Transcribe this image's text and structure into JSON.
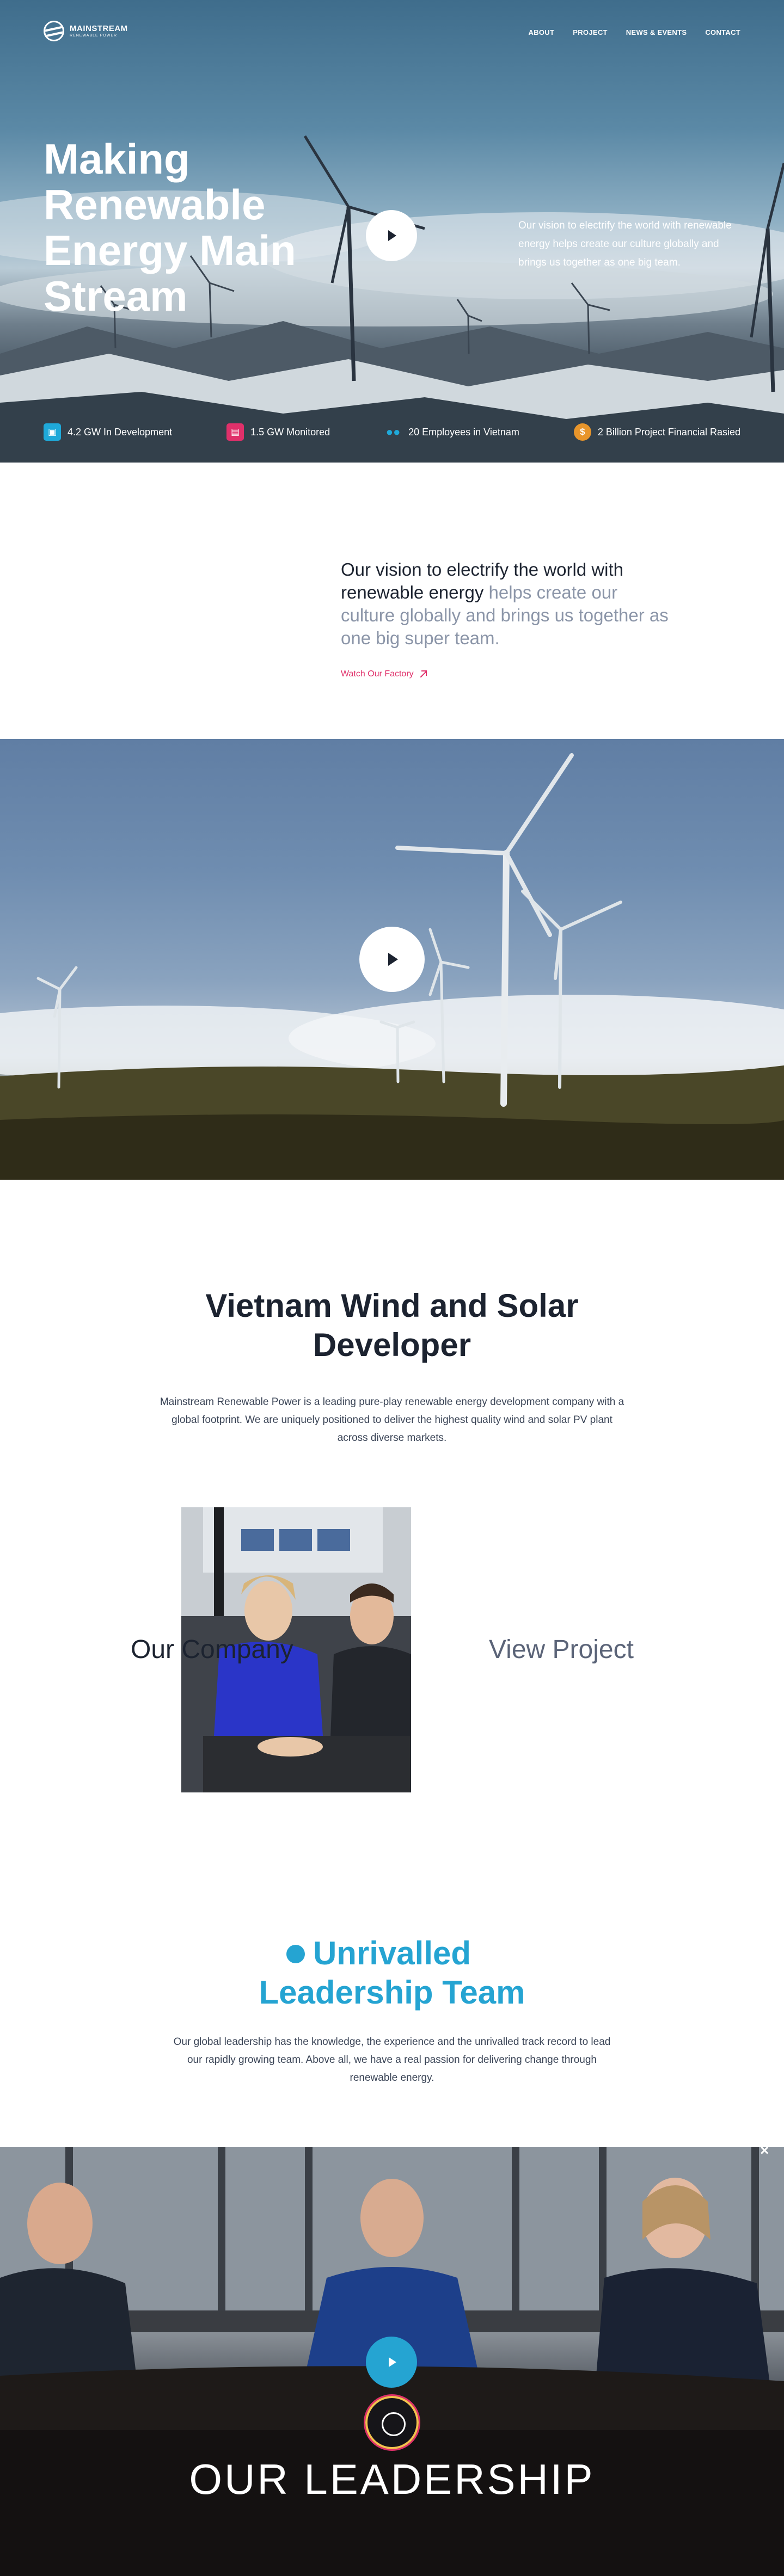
{
  "brand": {
    "name_line1": "MAINSTREAM",
    "name_line2": "RENEWABLE POWER"
  },
  "nav": [
    "ABOUT",
    "PROJECT",
    "NEWS & EVENTS",
    "CONTACT"
  ],
  "hero": {
    "title": "Making Renewable Energy Main Stream",
    "vision": "Our vision to electrify the world with renewable energy helps create our culture globally and brings us together as one big team."
  },
  "stats": [
    {
      "label": "4.2 GW In Development",
      "icon": "cube-icon",
      "color": "#1fa9d9"
    },
    {
      "label": "1.5 GW Monitored",
      "icon": "chart-icon",
      "color": "#e0306a"
    },
    {
      "label": "20 Employees in Vietnam",
      "icon": "people-icon",
      "color": "#1fa9d9"
    },
    {
      "label": "2 Billion Project Financial Rasied",
      "icon": "dollar-icon",
      "color": "#e8952b"
    }
  ],
  "intro": {
    "dark": "Our vision to electrify the world with renewable energy",
    "muted": " helps create our culture globally and brings us together as one big super team.",
    "link": "Watch Our Factory"
  },
  "developer": {
    "title": "Vietnam Wind and Solar Developer",
    "description": "Mainstream Renewable Power is a leading pure-play renewable energy development company with a global footprint. We are uniquely positioned to deliver the highest quality wind and solar PV plant across diverse markets.",
    "company_link": "Our Company",
    "project_link": "View Project"
  },
  "leadership": {
    "title": "Unrivalled Leadership Team",
    "description": "Our global leadership has the knowledge, the experience and the unrivalled track record to lead our rapidly growing team. Above all, we have a real passion for delivering change through renewable energy.",
    "video_caption": "OUR LEADERSHIP",
    "close": "×"
  },
  "colors": {
    "accent_blue": "#25a4d2",
    "accent_pink": "#e0306a",
    "text_dark": "#1c2330",
    "text_muted": "#8b95a8"
  }
}
